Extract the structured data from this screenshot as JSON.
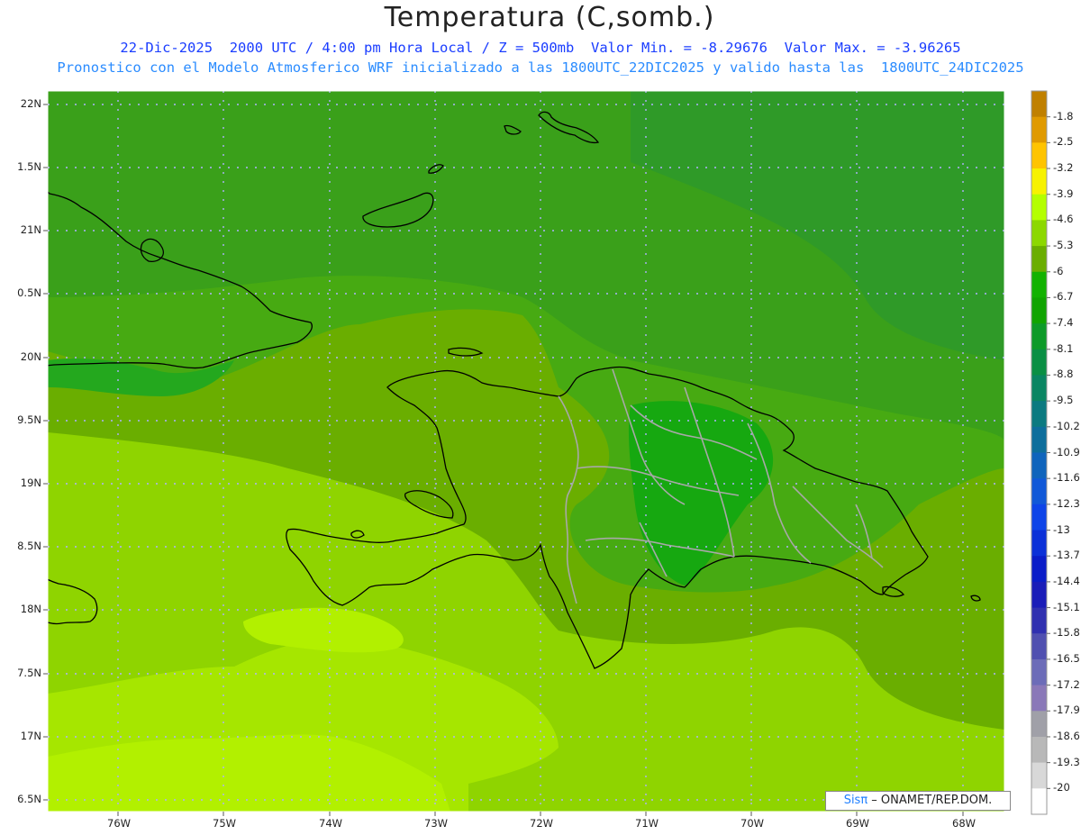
{
  "title": "Temperatura (C,somb.)",
  "subtitle_line1": "22-Dic-2025  2000 UTC / 4:00 pm Hora Local / Z = 500mb  Valor Min. = -8.29676  Valor Max. = -3.96265",
  "subtitle_line2": "Pronostico con el Modelo Atmosferico WRF inicializado a las 1800UTC_22DIC2025 y valido hasta las  1800UTC_24DIC2025",
  "credit": {
    "brand": "Sisπ",
    "rest": " – ONAMET/REP.DOM."
  },
  "lat_labels": [
    "22N",
    "1.5N",
    "21N",
    "0.5N",
    "20N",
    "9.5N",
    "19N",
    "8.5N",
    "18N",
    "7.5N",
    "17N",
    "6.5N"
  ],
  "lon_labels": [
    "76W",
    "75W",
    "74W",
    "73W",
    "72W",
    "71W",
    "70W",
    "69W",
    "68W"
  ],
  "colorbar": {
    "labels": [
      "-1.8",
      "-2.5",
      "-3.2",
      "-3.9",
      "-4.6",
      "-5.3",
      "-6",
      "-6.7",
      "-7.4",
      "-8.1",
      "-8.8",
      "-9.5",
      "-10.2",
      "-10.9",
      "-11.6",
      "-12.3",
      "-13",
      "-13.7",
      "-14.4",
      "-15.1",
      "-15.8",
      "-16.5",
      "-17.2",
      "-17.9",
      "-18.6",
      "-19.3",
      "-20"
    ],
    "colors": [
      "#c08000",
      "#e09a00",
      "#ffc400",
      "#f7f200",
      "#b4ff00",
      "#8cd800",
      "#6aae00",
      "#12b200",
      "#10a400",
      "#0d9a28",
      "#0a8f44",
      "#0a8562",
      "#0b7a80",
      "#0d6e9c",
      "#0f64bc",
      "#1058d8",
      "#0d44e8",
      "#0b30d8",
      "#0a1cc8",
      "#1a1cb8",
      "#3030b0",
      "#5050b0",
      "#6c6cb8",
      "#8a78b8",
      "#a0a0a8",
      "#b8b8b8",
      "#d8d8d8",
      "#ffffff"
    ]
  },
  "colors": {
    "dark_green": "#3a9f1a",
    "mid_green": "#4eae10",
    "olive_green": "#6aae00",
    "light_green": "#8fd400",
    "yellow_green": "#b2f000",
    "coast": "#000000",
    "border": "#a8a8a8",
    "grid": "#b0b0ff"
  }
}
